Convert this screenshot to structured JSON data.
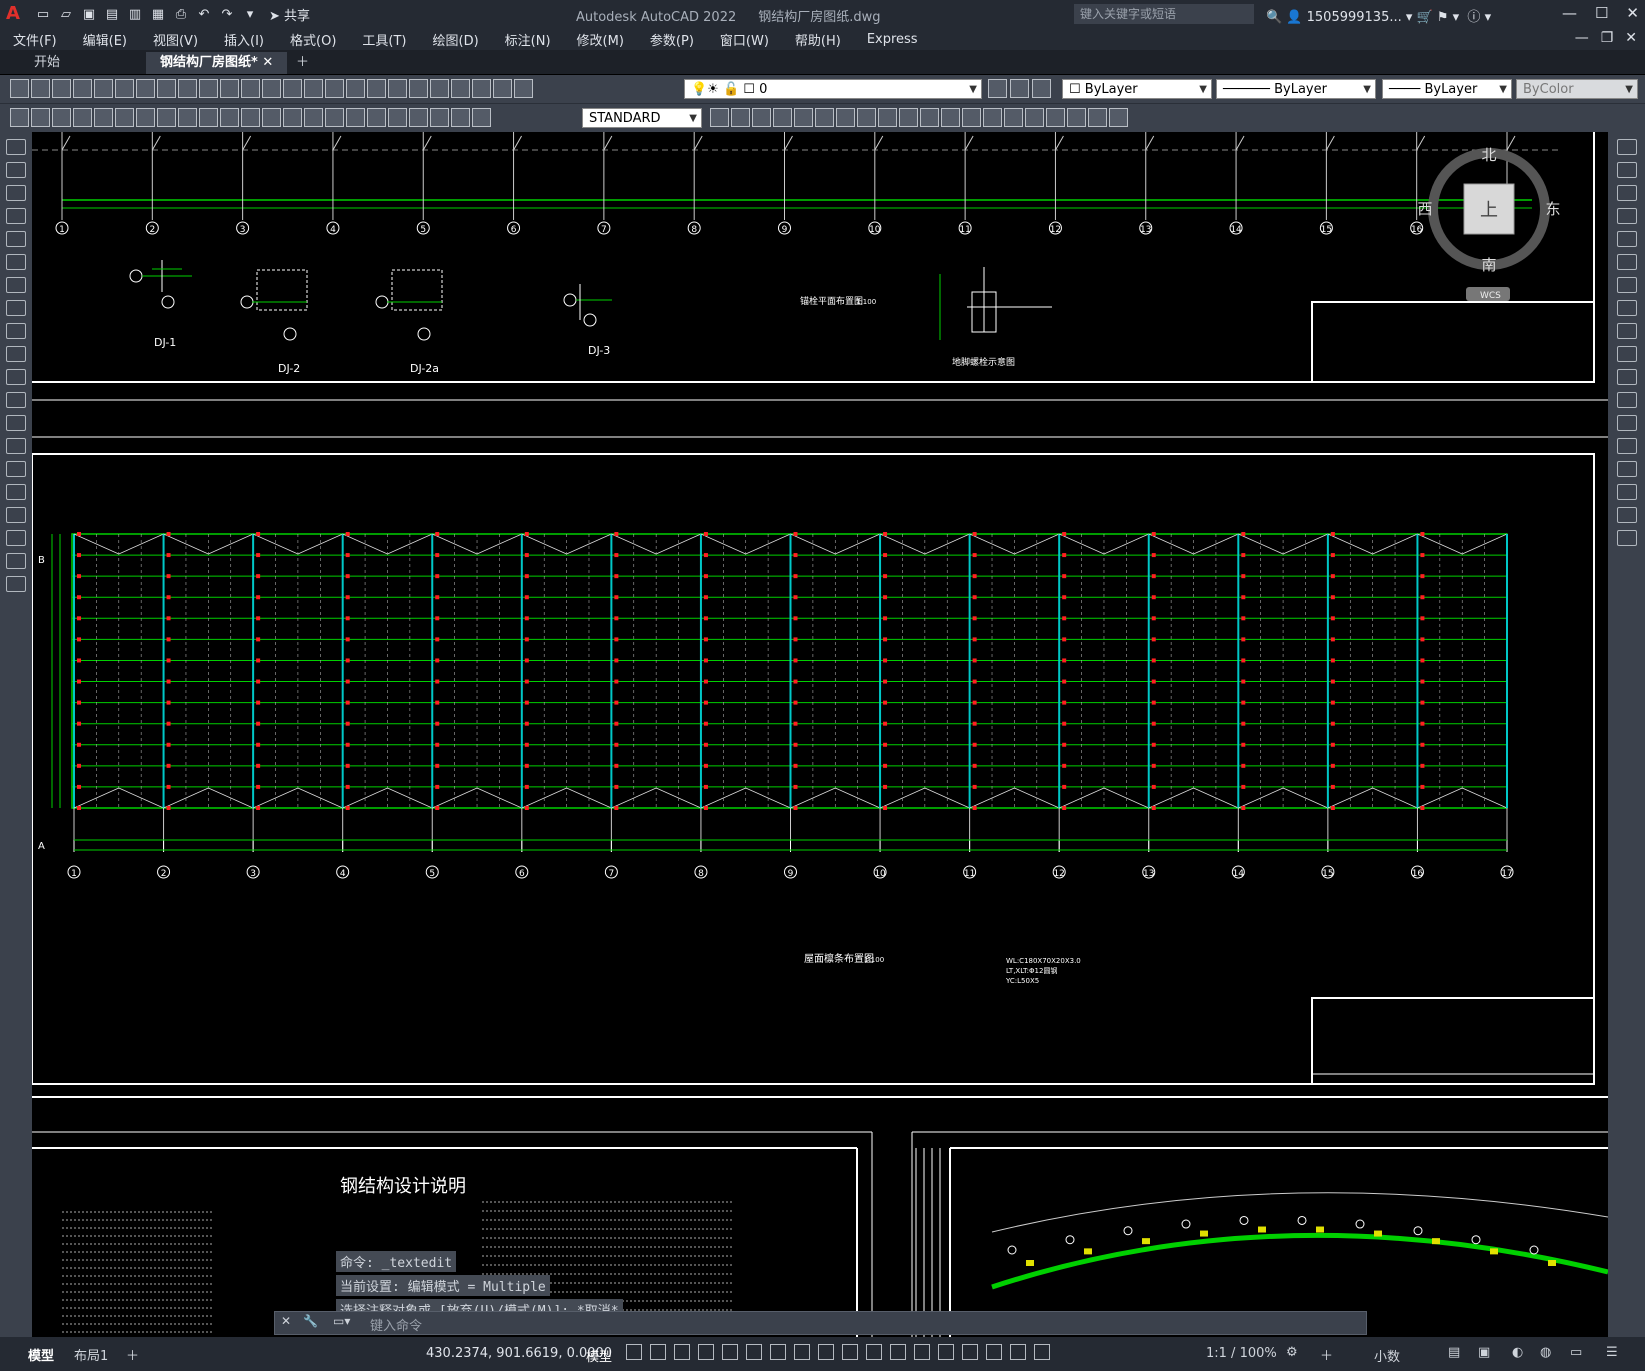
{
  "app": {
    "title": "Autodesk AutoCAD 2022",
    "filename": "钢结构厂房图纸.dwg",
    "search_placeholder": "键入关键字或短语",
    "user": "1505999135...",
    "share_label": "共享",
    "colors": {
      "brand": "#e0302b",
      "titlebar": "#252a33",
      "panel": "#3b414c",
      "canvas": "#000000",
      "drawing_green": "#00d000",
      "drawing_cyan": "#00c8c8",
      "drawing_red": "#ff2020"
    }
  },
  "menu": {
    "items": [
      "文件(F)",
      "编辑(E)",
      "视图(V)",
      "插入(I)",
      "格式(O)",
      "工具(T)",
      "绘图(D)",
      "标注(N)",
      "修改(M)",
      "参数(P)",
      "窗口(W)",
      "帮助(H)",
      "Express"
    ]
  },
  "tabs": {
    "start": "开始",
    "drawing": "钢结构厂房图纸*",
    "add_icon": "plus-icon"
  },
  "toolbars": {
    "layer_value": "0",
    "text_style": "STANDARD",
    "color": "ByLayer",
    "linetype": "ByLayer",
    "lineweight": "ByLayer",
    "plotstyle": "ByColor"
  },
  "viewcube": {
    "north": "北",
    "south": "南",
    "east": "东",
    "west": "西",
    "face": "上",
    "wcs": "WCS"
  },
  "drawing": {
    "grid_numbers": [
      "1",
      "2",
      "3",
      "4",
      "5",
      "6",
      "7",
      "8",
      "9",
      "10",
      "11",
      "12",
      "13",
      "14",
      "15",
      "16",
      "17"
    ],
    "foundation_labels": [
      "DJ-1",
      "DJ-2",
      "DJ-2a",
      "DJ-3"
    ],
    "anchor_plan_title": "锚栓平面布置图",
    "anchor_plan_scale": "1:100",
    "anchor_detail_title": "地脚螺栓示意图",
    "roof_plan_title": "屋面檩条布置图",
    "roof_plan_scale": "1:100",
    "roof_notes": [
      "WL:C180X70X20X3.0",
      "LT,XLT:Φ12圆钢",
      "YC:L50X5"
    ],
    "axis_letters": [
      "B",
      "A"
    ],
    "design_title": "钢结构设计说明"
  },
  "command": {
    "history": [
      "命令: _textedit",
      "当前设置: 编辑模式 = Multiple",
      "选择注释对象或 [放弃(U)/模式(M)]: *取消*"
    ],
    "input_placeholder": "键入命令"
  },
  "status": {
    "model_tab": "模型",
    "layout_tab": "布局1",
    "coordinates": "430.2374, 901.6619, 0.0000",
    "mode": "模型",
    "scale": "1:1 / 100%",
    "units": "小数"
  }
}
